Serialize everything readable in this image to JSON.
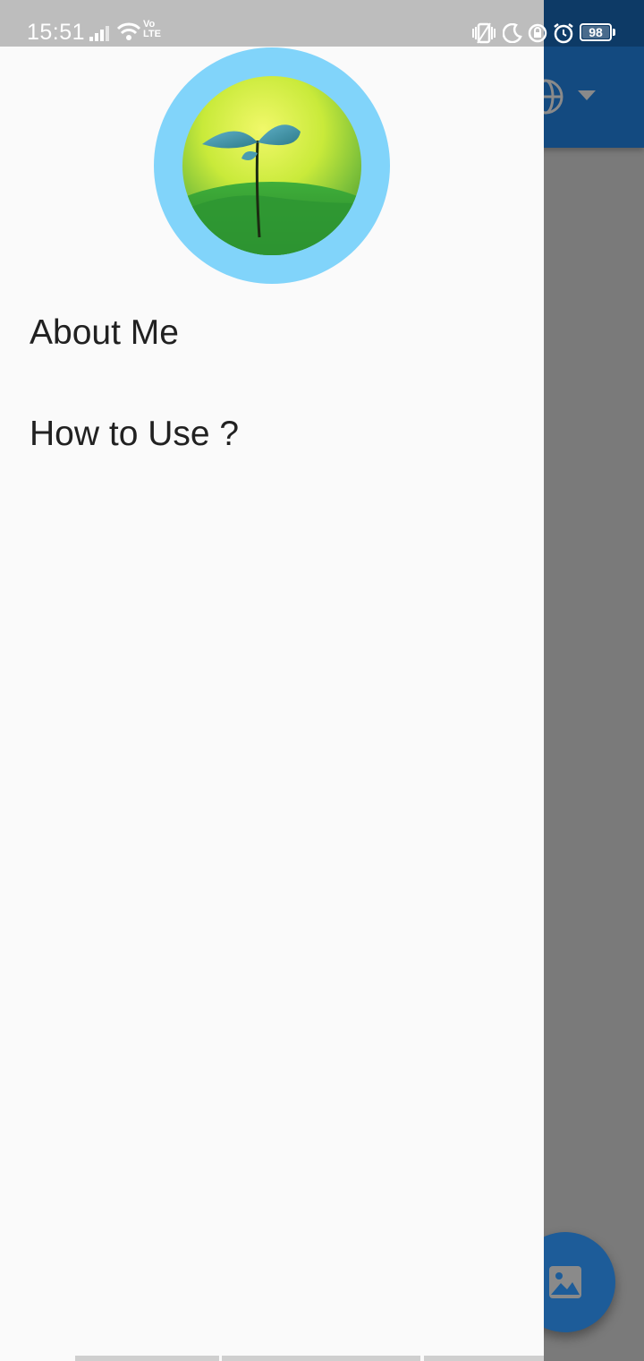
{
  "status_bar": {
    "time": "15:51",
    "network_label": "Vo LTE",
    "battery_level": "98",
    "icons": [
      "signal-icon",
      "wifi-icon",
      "volte-icon",
      "vibrate-icon",
      "do-not-disturb-moon-icon",
      "lock-rotation-icon",
      "alarm-icon",
      "battery-icon"
    ]
  },
  "app_bar": {
    "icons": [
      "globe-icon",
      "dropdown-caret-icon"
    ],
    "color": "#134a80"
  },
  "drawer": {
    "avatar": "sprout-plant-image",
    "avatar_ring_color": "#81d4fa",
    "items": [
      {
        "label": "About Me"
      },
      {
        "label": "How to Use ?"
      }
    ]
  },
  "fab": {
    "icon": "image-icon",
    "color": "#1d5c99"
  }
}
